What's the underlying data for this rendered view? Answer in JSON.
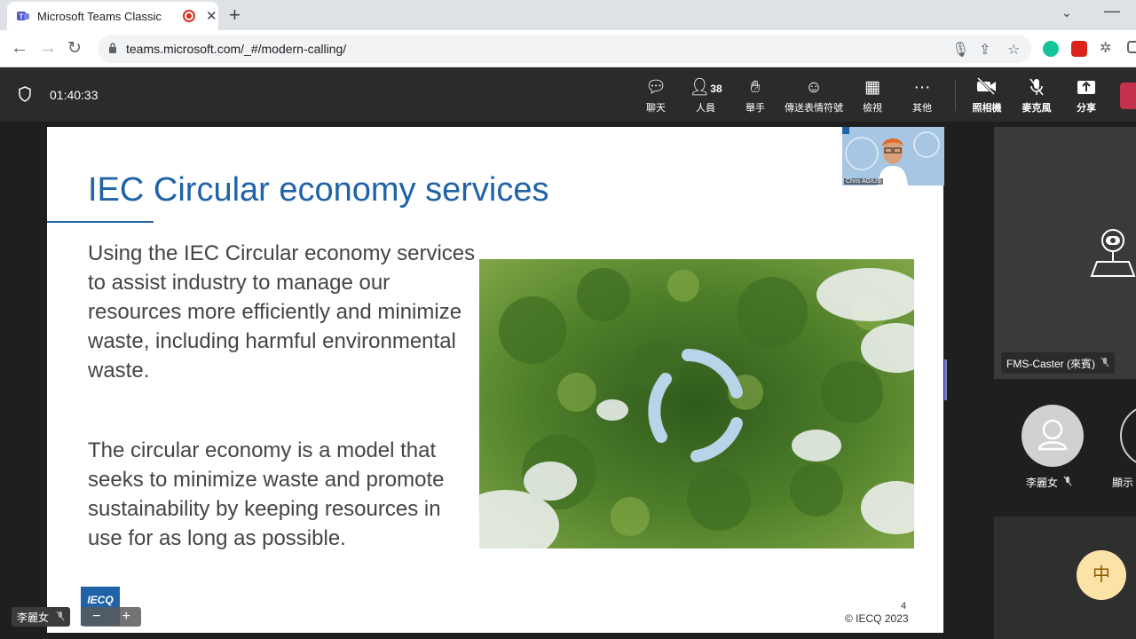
{
  "browser": {
    "tab_title": "Microsoft Teams Classic",
    "url": "teams.microsoft.com/_#/modern-calling/"
  },
  "meeting": {
    "timer": "01:40:33",
    "toolbar": {
      "chat": "聊天",
      "people": "人員",
      "people_count": "38",
      "raise_hand": "舉手",
      "reactions": "傳送表情符號",
      "view": "檢視",
      "more": "其他",
      "camera": "照相機",
      "mic": "麥克風",
      "share": "分享"
    }
  },
  "slide": {
    "title": "IEC Circular economy services",
    "para1": "Using the IEC Circular economy services to assist industry to manage our resources more efficiently and minimize waste, including harmful environmental waste.",
    "para2": "The circular economy is a model that seeks to minimize waste and promote sustainability by keeping resources in use for as long as possible.",
    "page_number": "4",
    "copyright": "© IECQ 2023",
    "logo_text": "IECQ"
  },
  "presenter_pip_name": "Chris AGIUS",
  "self_view": {
    "name": "李麗女"
  },
  "zoom": {
    "minus": "−",
    "plus": "+"
  },
  "participants": {
    "caster": "FMS-Caster (來賓)",
    "p1": "李麗女",
    "p2": "顯示"
  },
  "ime": "中",
  "colors": {
    "accent_blue": "#1f62a8",
    "leave_red": "#c4314b",
    "teams_bar": "#2b2b2b"
  }
}
